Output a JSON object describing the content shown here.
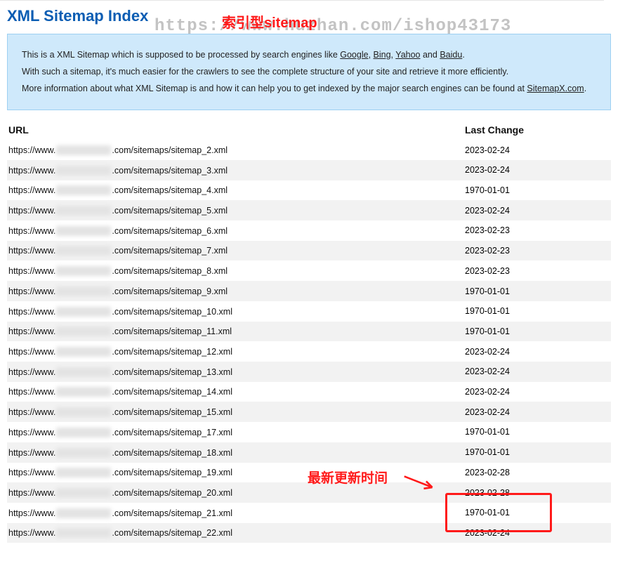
{
  "title": "XML Sitemap Index",
  "annotations": {
    "watermark": "https://www.huzhan.com/ishop43173",
    "top_label": "索引型sitemap",
    "latest_label": "最新更新时间"
  },
  "info": {
    "line1_pre": "This is a XML Sitemap which is supposed to be processed by search engines like ",
    "google": "Google",
    "bing": "Bing",
    "yahoo": "Yahoo",
    "and": " and ",
    "baidu": "Baidu",
    "period": ".",
    "line2": "With such a sitemap, it's much easier for the crawlers to see the complete structure of your site and retrieve it more efficiently.",
    "line3_pre": "More information about what XML Sitemap is and how it can help you to get indexed by the major search engines can be found at ",
    "sitemapx": "SitemapX.com"
  },
  "columns": {
    "url": "URL",
    "last": "Last Change"
  },
  "url_parts": {
    "prefix": "https://www.",
    "mid": ".com/sitemaps/sitemap_",
    "suffix": ".xml"
  },
  "rows": [
    {
      "n": "2",
      "date": "2023-02-24"
    },
    {
      "n": "3",
      "date": "2023-02-24"
    },
    {
      "n": "4",
      "date": "1970-01-01"
    },
    {
      "n": "5",
      "date": "2023-02-24"
    },
    {
      "n": "6",
      "date": "2023-02-23"
    },
    {
      "n": "7",
      "date": "2023-02-23"
    },
    {
      "n": "8",
      "date": "2023-02-23"
    },
    {
      "n": "9",
      "date": "1970-01-01"
    },
    {
      "n": "10",
      "date": "1970-01-01"
    },
    {
      "n": "11",
      "date": "1970-01-01"
    },
    {
      "n": "12",
      "date": "2023-02-24"
    },
    {
      "n": "13",
      "date": "2023-02-24"
    },
    {
      "n": "14",
      "date": "2023-02-24"
    },
    {
      "n": "15",
      "date": "2023-02-24"
    },
    {
      "n": "17",
      "date": "1970-01-01"
    },
    {
      "n": "18",
      "date": "1970-01-01"
    },
    {
      "n": "19",
      "date": "2023-02-28"
    },
    {
      "n": "20",
      "date": "2023-02-28"
    },
    {
      "n": "21",
      "date": "1970-01-01"
    },
    {
      "n": "22",
      "date": "2023-02-24"
    }
  ]
}
